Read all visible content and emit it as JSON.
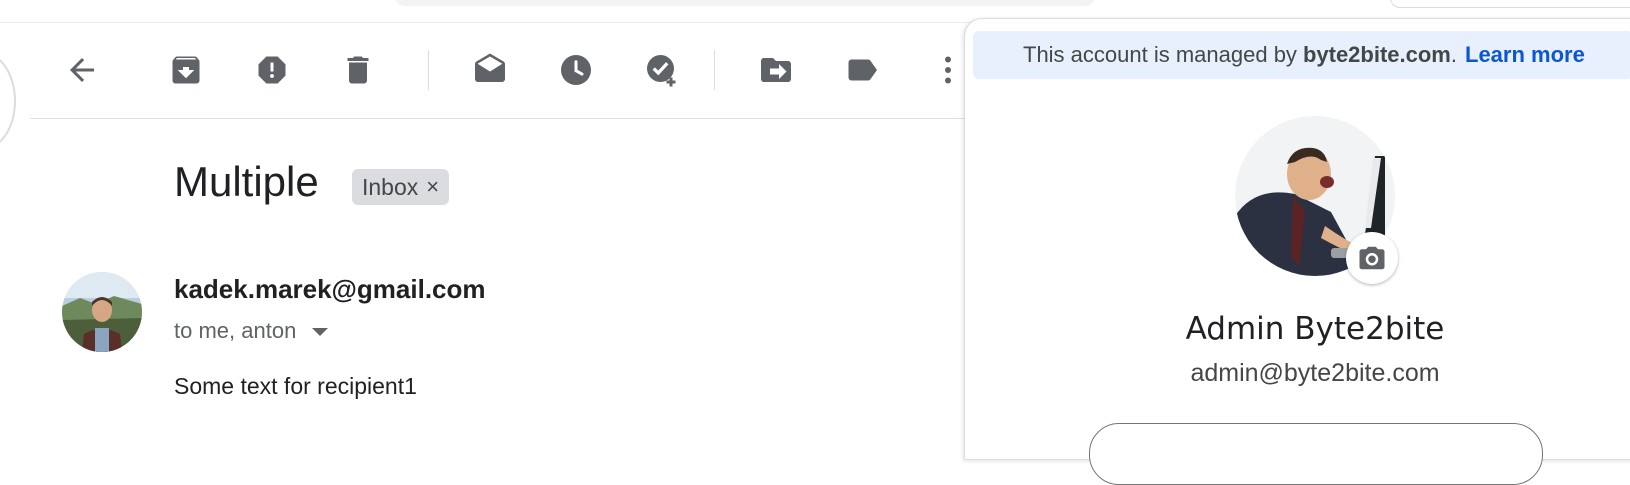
{
  "toolbar": {
    "buttons": [
      {
        "name": "back",
        "icon": "arrow-left-icon"
      },
      {
        "name": "archive",
        "icon": "archive-icon"
      },
      {
        "name": "report-spam",
        "icon": "report-spam-icon"
      },
      {
        "name": "delete",
        "icon": "trash-icon"
      },
      {
        "name": "mark-unread",
        "icon": "mark-unread-icon"
      },
      {
        "name": "snooze",
        "icon": "clock-icon"
      },
      {
        "name": "add-to-tasks",
        "icon": "add-task-icon"
      },
      {
        "name": "move-to",
        "icon": "move-to-icon"
      },
      {
        "name": "labels",
        "icon": "label-icon"
      },
      {
        "name": "more",
        "icon": "more-vert-icon"
      }
    ]
  },
  "email": {
    "subject": "Multiple",
    "label_chip": "Inbox",
    "label_remove": "×",
    "sender": "kadek.marek@gmail.com",
    "recipients": "to me, anton",
    "body": "Some text for recipient1"
  },
  "account_panel": {
    "managed_prefix": "This account is managed by",
    "managed_domain": "byte2bite.com",
    "managed_period": ".",
    "learn_more": "Learn more",
    "name": "Admin Byte2bite",
    "email": "admin@byte2bite.com",
    "camera_icon": "camera-icon"
  },
  "colors": {
    "accent_link": "#0b57d0",
    "banner_bg": "#e8f0fe",
    "icon_gray": "#5f6368"
  }
}
